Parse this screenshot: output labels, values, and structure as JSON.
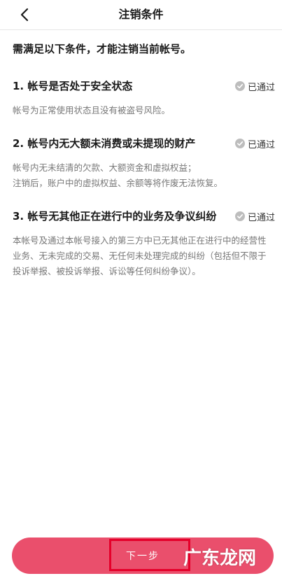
{
  "nav": {
    "title": "注销条件",
    "back_icon": "chevron-left-icon"
  },
  "intro": "需满足以下条件，才能注销当前帐号。",
  "conditions": [
    {
      "title": "1. 帐号是否处于安全状态",
      "status": "已通过",
      "desc": [
        "帐号为正常使用状态且没有被盗号风险。"
      ]
    },
    {
      "title": "2. 帐号内无大额未消费或未提现的财产",
      "status": "已通过",
      "desc": [
        "帐号内无未结清的欠款、大额资金和虚拟权益；",
        "注销后，账户中的虚拟权益、余额等将作废无法恢复。"
      ]
    },
    {
      "title": "3. 帐号无其他正在进行中的业务及争议纠纷",
      "status": "已通过",
      "desc": [
        "本帐号及通过本帐号接入的第三方中已无其他正在进行中的经营性业务、无未完成的交易、无任何未处理完成的纠纷（包括但不限于投诉举报、被投诉举报、诉讼等任何纠纷争议）。"
      ]
    }
  ],
  "next_button": "下一步",
  "watermark": "广东龙网",
  "colors": {
    "accent": "#ea4f6c",
    "highlight": "#e5002a",
    "status_icon": "#bdbdbd"
  }
}
